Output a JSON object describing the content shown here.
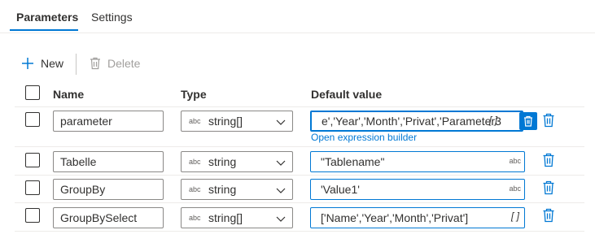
{
  "tabs": [
    {
      "label": "Parameters",
      "active": true
    },
    {
      "label": "Settings",
      "active": false
    }
  ],
  "toolbar": {
    "new_label": "New",
    "delete_label": "Delete"
  },
  "columns": {
    "name": "Name",
    "type": "Type",
    "default_value": "Default value"
  },
  "rows": [
    {
      "name": "parameter",
      "type": "string[]",
      "value": "e','Year','Month','Privat','Parameter3",
      "hint": "[ ]",
      "active": true
    },
    {
      "name": "Tabelle",
      "type": "string",
      "value": "\"Tablename\"",
      "hint": "abc"
    },
    {
      "name": "GroupBy",
      "type": "string",
      "value": "'Value1'",
      "hint": "abc"
    },
    {
      "name": "GroupBySelect",
      "type": "string[]",
      "value": "['Name','Year','Month','Privat']",
      "hint": "[ ]"
    }
  ],
  "expression_builder_label": "Open expression builder",
  "type_icon": "abc",
  "colors": {
    "accent": "#0078d4",
    "text": "#323130",
    "disabled": "#a19f9d"
  }
}
